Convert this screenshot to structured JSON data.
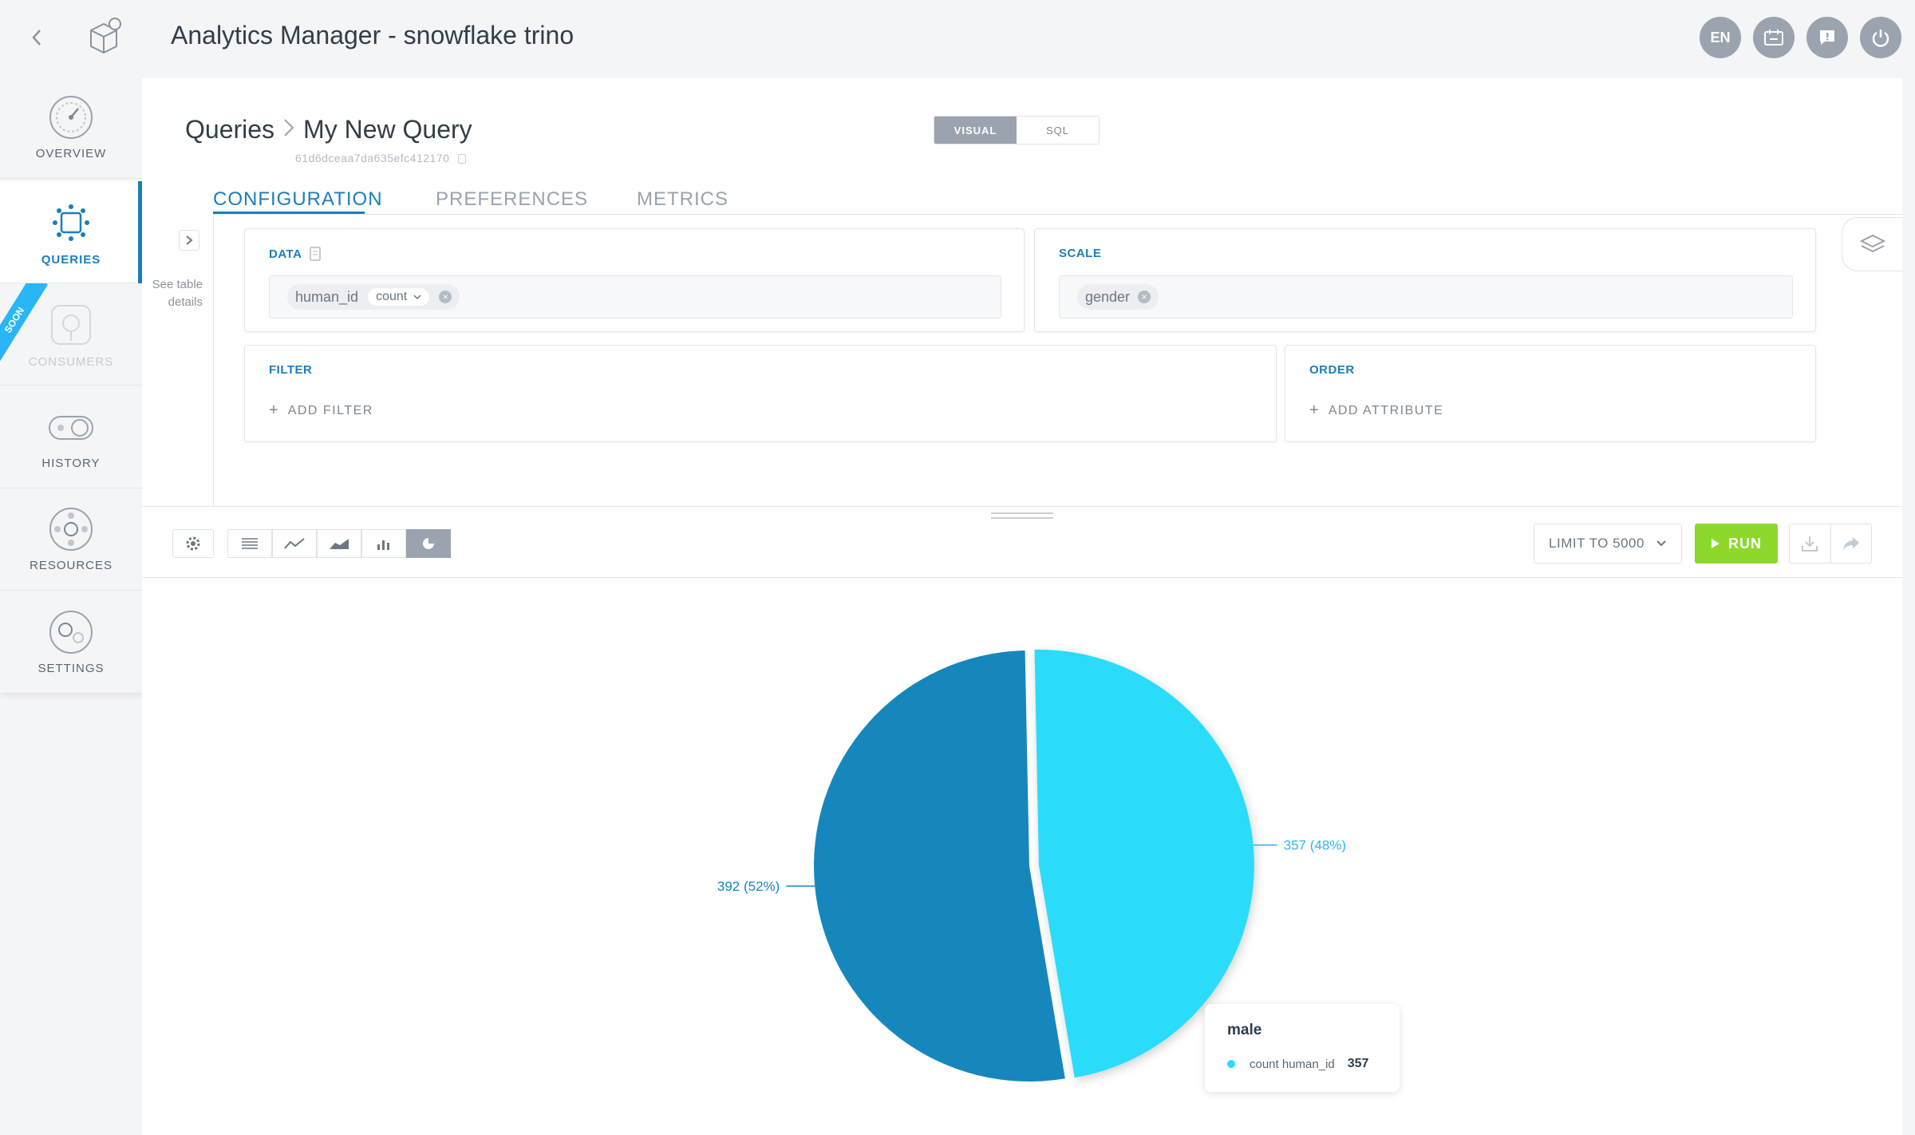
{
  "header": {
    "back_icon": "chevron-left-icon",
    "logo_icon": "cube-logo-icon",
    "title": "Analytics Manager - snowflake trino",
    "lang_label": "EN",
    "buttons": [
      "calendar-icon",
      "feedback-icon",
      "power-icon"
    ]
  },
  "sidebar": {
    "items": [
      {
        "label": "OVERVIEW",
        "icon": "dashboard-icon"
      },
      {
        "label": "QUERIES",
        "icon": "queries-icon"
      },
      {
        "label": "CONSUMERS",
        "icon": "consumers-icon",
        "ribbon": "SOON"
      },
      {
        "label": "HISTORY",
        "icon": "history-icon"
      },
      {
        "label": "RESOURCES",
        "icon": "resources-icon"
      },
      {
        "label": "SETTINGS",
        "icon": "settings-icon"
      }
    ]
  },
  "breadcrumb": {
    "parent": "Queries",
    "current": "My New Query",
    "query_id": "61d6dceaa7da635efc412170"
  },
  "mode_toggle": {
    "visual": "VISUAL",
    "sql": "SQL",
    "selected": "VISUAL"
  },
  "tabs": [
    {
      "label": "CONFIGURATION",
      "active": true
    },
    {
      "label": "PREFERENCES",
      "active": false
    },
    {
      "label": "METRICS",
      "active": false
    }
  ],
  "table_details": {
    "label": "See table details"
  },
  "data_card": {
    "title": "DATA",
    "chip_field": "human_id",
    "chip_agg": "count"
  },
  "scale_card": {
    "title": "SCALE",
    "chip_field": "gender"
  },
  "filter_card": {
    "title": "FILTER",
    "add_label": "ADD FILTER"
  },
  "order_card": {
    "title": "ORDER",
    "add_label": "ADD ATTRIBUTE"
  },
  "toolbar": {
    "settings_icon": "gear-icon",
    "chart_types": [
      "table",
      "line",
      "area",
      "bar",
      "pie"
    ],
    "selected_chart_type": "pie",
    "limit_label": "LIMIT TO 5000",
    "run_label": "RUN",
    "download_icon": "download-icon",
    "share_icon": "share-icon"
  },
  "colors": {
    "accent": "#1a7fb8",
    "run": "#8cd92b",
    "slice_dark": "#1687bd",
    "slice_light": "#29dcfa"
  },
  "chart_data": {
    "type": "pie",
    "series": [
      {
        "label": "male",
        "value": 357,
        "percent": 48
      },
      {
        "label": "",
        "value": 392,
        "percent": 52
      }
    ],
    "slice_labels": [
      "357 (48%)",
      "392 (52%)"
    ]
  },
  "tooltip": {
    "title": "male",
    "metric": "count human_id",
    "value": "357"
  }
}
